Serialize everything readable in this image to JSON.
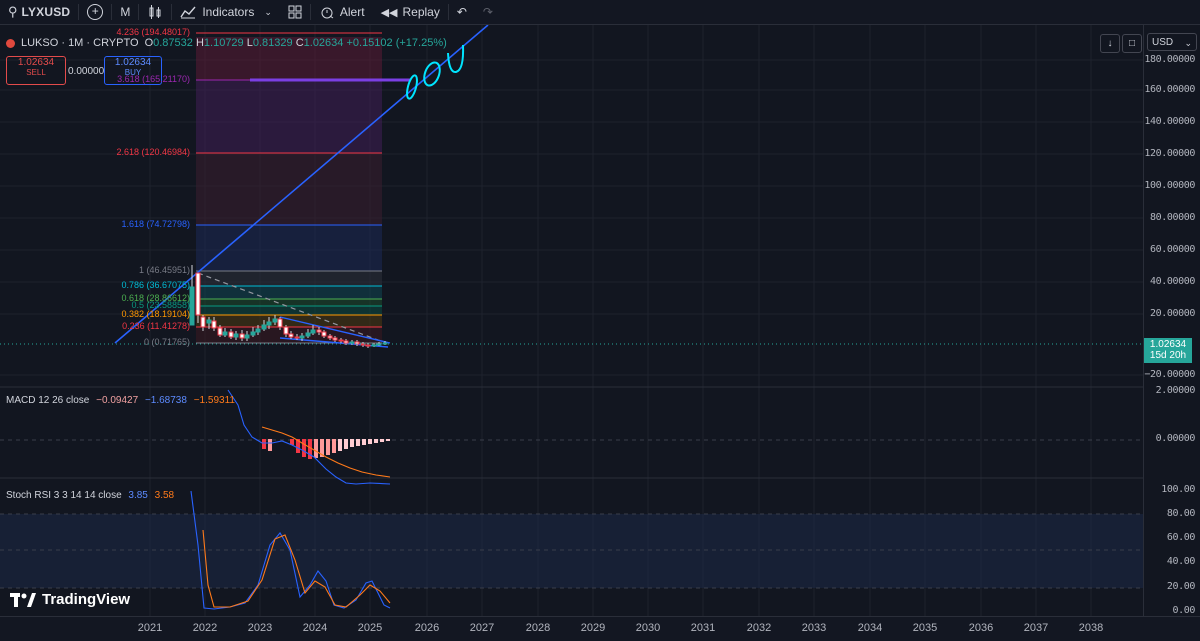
{
  "toolbar": {
    "symbol": "LYXUSD",
    "interval": "M",
    "indicators": "Indicators",
    "alert": "Alert",
    "replay": "Replay"
  },
  "legend": {
    "name": "LUKSO · 1M · CRYPTO",
    "o_label": "O",
    "o": "0.87532",
    "h_label": "H",
    "h": "1.10729",
    "l_label": "L",
    "l": "0.81329",
    "c_label": "C",
    "c": "1.02634",
    "change": "+0.15102 (+17.25%)"
  },
  "trade": {
    "sell_price": "1.02634",
    "sell_label": "SELL",
    "spread": "0.00000",
    "buy_price": "1.02634",
    "buy_label": "BUY"
  },
  "currency": "USD",
  "price_tag": {
    "price": "1.02634",
    "countdown": "15d 20h"
  },
  "fib_levels": [
    {
      "label": "4.236 (194.48017)",
      "color": "#f23645"
    },
    {
      "label": "3.618 (165.21170)",
      "color": "#9c27b0"
    },
    {
      "label": "2.618 (120.46984)",
      "color": "#f23645"
    },
    {
      "label": "1.618 (74.72798)",
      "color": "#2962ff"
    },
    {
      "label": "1 (46.45951)",
      "color": "#787b86"
    },
    {
      "label": "0.786 (36.67075)",
      "color": "#00bcd4"
    },
    {
      "label": "0.618 (28.86612)",
      "color": "#4caf50"
    },
    {
      "label": "0.5 (23.58858)",
      "color": "#089981"
    },
    {
      "label": "0.382 (18.19104)",
      "color": "#ff9800"
    },
    {
      "label": "0.236 (11.41278)",
      "color": "#f23645"
    },
    {
      "label": "0 (0.71765)",
      "color": "#787b86"
    }
  ],
  "price_axis": [
    "180.00000",
    "160.00000",
    "140.00000",
    "120.00000",
    "100.00000",
    "80.00000",
    "60.00000",
    "40.00000",
    "20.00000",
    "−20.00000"
  ],
  "macd": {
    "label": "MACD 12 26 close",
    "v1": "−0.09427",
    "v2": "−1.68738",
    "v3": "−1.59311",
    "axis": [
      "2.00000",
      "0.00000"
    ]
  },
  "stoch": {
    "label": "Stoch RSI 3 3 14 14 close",
    "k": "3.85",
    "d": "3.58",
    "axis": [
      "100.00",
      "80.00",
      "60.00",
      "40.00",
      "20.00",
      "0.00"
    ]
  },
  "time_axis": [
    "2021",
    "2022",
    "2023",
    "2024",
    "2025",
    "2026",
    "2027",
    "2028",
    "2029",
    "2030",
    "2031",
    "2032",
    "2033",
    "2034",
    "2035",
    "2036",
    "2037",
    "2038"
  ],
  "brand": "TradingView",
  "colors": {
    "up": "#26a69a",
    "down": "#f23645",
    "accent": "#2962ff",
    "cyan_annotation": "#00e5ff"
  }
}
